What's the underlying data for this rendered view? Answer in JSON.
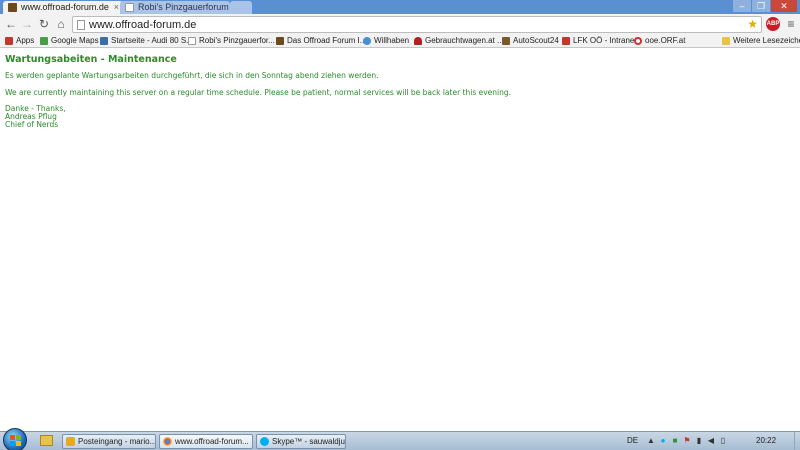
{
  "browser": {
    "tabs": [
      {
        "label": "www.offroad-forum.de"
      },
      {
        "label": "Robi's Pinzgauerforum • I"
      }
    ],
    "address": "www.offroad-forum.de",
    "bookmarks": [
      {
        "label": "Apps",
        "icon": "apps-grid-icon",
        "color": "#c0392b"
      },
      {
        "label": "Google Maps",
        "icon": "google-maps-icon",
        "color": "#4a9b4a"
      },
      {
        "label": "Startseite - Audi 80 S...",
        "icon": "audi-forum-icon",
        "color": "#3a6ea5"
      },
      {
        "label": "Robi's Pinzgauerfor...",
        "icon": "page-icon",
        "color": "#dddddd"
      },
      {
        "label": "Das Offroad Forum I...",
        "icon": "offroad-forum-icon",
        "color": "#6b4a1e"
      },
      {
        "label": "Willhaben",
        "icon": "willhaben-icon",
        "color": "#4a8fd0"
      },
      {
        "label": "Gebrauchtwagen.at ...",
        "icon": "car-icon",
        "color": "#b02222"
      },
      {
        "label": "AutoScout24",
        "icon": "autoscout-icon",
        "color": "#7a5a2a"
      },
      {
        "label": "LFK OÖ - Intranet",
        "icon": "lfk-icon",
        "color": "#c0392b"
      },
      {
        "label": "ooe.ORF.at",
        "icon": "orf-icon",
        "color": "#d32f2f"
      }
    ],
    "other_bookmarks": "Weitere Lesezeichen"
  },
  "page": {
    "heading": "Wartungsabeiten - Maintenance",
    "message_de": "Es werden geplante Wartungsarbeiten durchgeführt, die sich in den Sonntag abend ziehen werden.",
    "message_en": "We are currently maintaining this server on a regular time schedule. Please be patient, normal services will be back later this evening.",
    "signature": [
      "Danke - Thanks,",
      "Andreas Pflug",
      "Chief of Nerds"
    ],
    "text_color": "#2a8c2a"
  },
  "taskbar": {
    "tasks": [
      {
        "label": "Posteingang - mario...",
        "icon": "mail-icon",
        "color": "#e7a823"
      },
      {
        "label": "www.offroad-forum...",
        "icon": "chrome-icon",
        "color": "#dd4b39"
      },
      {
        "label": "Skype™ - sauwaldjun...",
        "icon": "skype-icon",
        "color": "#00aff0"
      }
    ],
    "language": "DE",
    "clock": "20:22"
  }
}
